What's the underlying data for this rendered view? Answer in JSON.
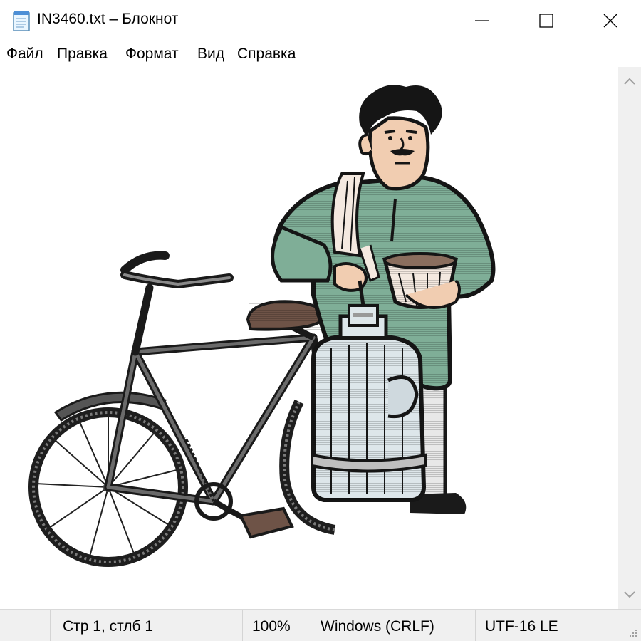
{
  "window": {
    "title": "IN3460.txt – Блокнот",
    "icon": "notepad-icon"
  },
  "menu": {
    "items": [
      "Файл",
      "Правка",
      "Формат",
      "Вид",
      "Справка"
    ]
  },
  "status": {
    "position": "Стр 1, стлб 1",
    "zoom": "100%",
    "line_ending": "Windows (CRLF)",
    "encoding": "UTF-16 LE"
  },
  "colors": {
    "shirt": "#7fae97",
    "skin": "#f1cdb1",
    "hair": "#151515",
    "metal": "#dde6ea",
    "saddle": "#6e5347",
    "frame": "#505050"
  }
}
